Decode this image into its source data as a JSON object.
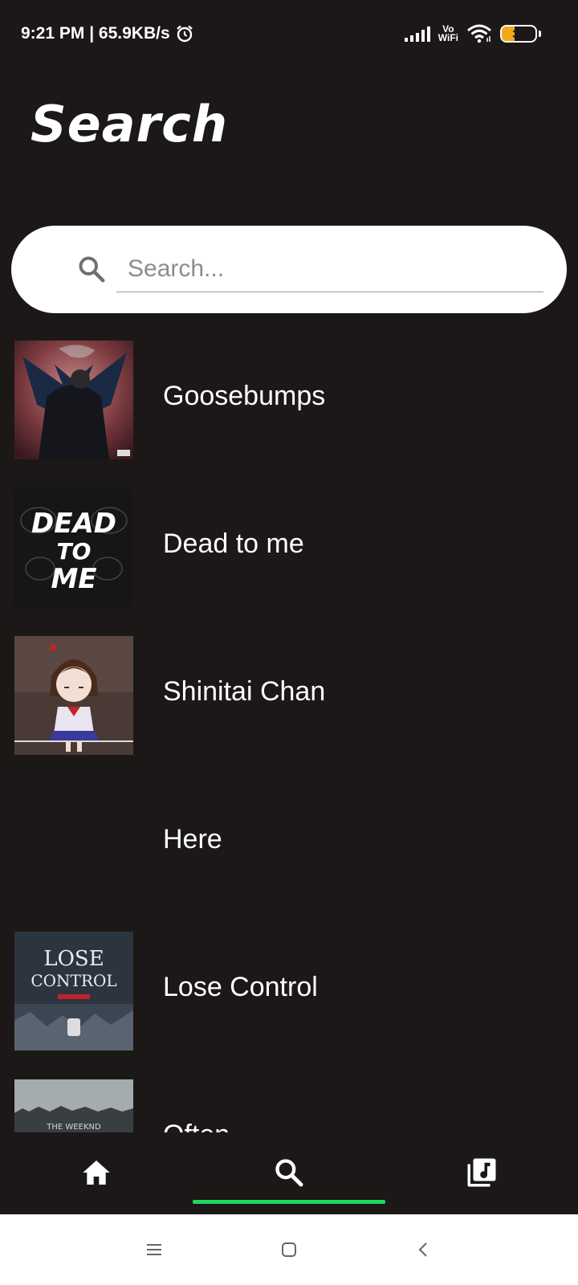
{
  "status_bar": {
    "time_speed": "9:21 PM | 65.9KB/s",
    "vowifi_top": "Vo",
    "vowifi_bottom": "WiFi",
    "battery_level": "39",
    "battery_fraction": 0.39,
    "battery_color": "#f5a81c"
  },
  "header": {
    "title": "Search"
  },
  "search": {
    "placeholder": "Search...",
    "value": ""
  },
  "songs": [
    {
      "title": "Goosebumps",
      "cover": "dark-winged-figure-art"
    },
    {
      "title": "Dead to me",
      "cover": "dead-to-me-text-art"
    },
    {
      "title": "Shinitai Chan",
      "cover": "anime-girl-art"
    },
    {
      "title": "Here",
      "cover": ""
    },
    {
      "title": "Lose Control",
      "cover": "lose-control-text-art"
    },
    {
      "title": "Often",
      "cover": "the-weeknd-often-art"
    }
  ],
  "cover_texts": {
    "dead_to_me_line1": "DEAD",
    "dead_to_me_line2": "TO",
    "dead_to_me_line3": "ME",
    "lose_control_line1": "LOSE",
    "lose_control_line2": "CONTROL",
    "often_artist": "THE WEEKND"
  },
  "bottom_nav": {
    "items": [
      "home-icon",
      "search-icon",
      "library-music-icon"
    ],
    "active_index": 1,
    "accent_color": "#1ed760"
  },
  "system_nav": {
    "items": [
      "menu-icon",
      "home-square-icon",
      "back-icon"
    ]
  },
  "colors": {
    "background": "#1b1817",
    "accent": "#1ed760"
  }
}
